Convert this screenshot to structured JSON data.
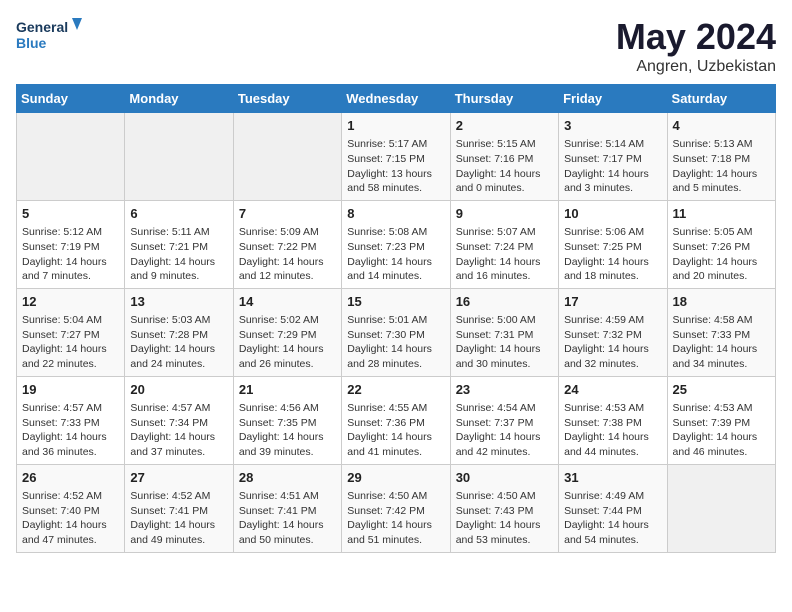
{
  "logo": {
    "line1": "General",
    "line2": "Blue"
  },
  "title": "May 2024",
  "location": "Angren, Uzbekistan",
  "days_header": [
    "Sunday",
    "Monday",
    "Tuesday",
    "Wednesday",
    "Thursday",
    "Friday",
    "Saturday"
  ],
  "weeks": [
    [
      {
        "day": "",
        "info": ""
      },
      {
        "day": "",
        "info": ""
      },
      {
        "day": "",
        "info": ""
      },
      {
        "day": "1",
        "info": "Sunrise: 5:17 AM\nSunset: 7:15 PM\nDaylight: 13 hours\nand 58 minutes."
      },
      {
        "day": "2",
        "info": "Sunrise: 5:15 AM\nSunset: 7:16 PM\nDaylight: 14 hours\nand 0 minutes."
      },
      {
        "day": "3",
        "info": "Sunrise: 5:14 AM\nSunset: 7:17 PM\nDaylight: 14 hours\nand 3 minutes."
      },
      {
        "day": "4",
        "info": "Sunrise: 5:13 AM\nSunset: 7:18 PM\nDaylight: 14 hours\nand 5 minutes."
      }
    ],
    [
      {
        "day": "5",
        "info": "Sunrise: 5:12 AM\nSunset: 7:19 PM\nDaylight: 14 hours\nand 7 minutes."
      },
      {
        "day": "6",
        "info": "Sunrise: 5:11 AM\nSunset: 7:21 PM\nDaylight: 14 hours\nand 9 minutes."
      },
      {
        "day": "7",
        "info": "Sunrise: 5:09 AM\nSunset: 7:22 PM\nDaylight: 14 hours\nand 12 minutes."
      },
      {
        "day": "8",
        "info": "Sunrise: 5:08 AM\nSunset: 7:23 PM\nDaylight: 14 hours\nand 14 minutes."
      },
      {
        "day": "9",
        "info": "Sunrise: 5:07 AM\nSunset: 7:24 PM\nDaylight: 14 hours\nand 16 minutes."
      },
      {
        "day": "10",
        "info": "Sunrise: 5:06 AM\nSunset: 7:25 PM\nDaylight: 14 hours\nand 18 minutes."
      },
      {
        "day": "11",
        "info": "Sunrise: 5:05 AM\nSunset: 7:26 PM\nDaylight: 14 hours\nand 20 minutes."
      }
    ],
    [
      {
        "day": "12",
        "info": "Sunrise: 5:04 AM\nSunset: 7:27 PM\nDaylight: 14 hours\nand 22 minutes."
      },
      {
        "day": "13",
        "info": "Sunrise: 5:03 AM\nSunset: 7:28 PM\nDaylight: 14 hours\nand 24 minutes."
      },
      {
        "day": "14",
        "info": "Sunrise: 5:02 AM\nSunset: 7:29 PM\nDaylight: 14 hours\nand 26 minutes."
      },
      {
        "day": "15",
        "info": "Sunrise: 5:01 AM\nSunset: 7:30 PM\nDaylight: 14 hours\nand 28 minutes."
      },
      {
        "day": "16",
        "info": "Sunrise: 5:00 AM\nSunset: 7:31 PM\nDaylight: 14 hours\nand 30 minutes."
      },
      {
        "day": "17",
        "info": "Sunrise: 4:59 AM\nSunset: 7:32 PM\nDaylight: 14 hours\nand 32 minutes."
      },
      {
        "day": "18",
        "info": "Sunrise: 4:58 AM\nSunset: 7:33 PM\nDaylight: 14 hours\nand 34 minutes."
      }
    ],
    [
      {
        "day": "19",
        "info": "Sunrise: 4:57 AM\nSunset: 7:33 PM\nDaylight: 14 hours\nand 36 minutes."
      },
      {
        "day": "20",
        "info": "Sunrise: 4:57 AM\nSunset: 7:34 PM\nDaylight: 14 hours\nand 37 minutes."
      },
      {
        "day": "21",
        "info": "Sunrise: 4:56 AM\nSunset: 7:35 PM\nDaylight: 14 hours\nand 39 minutes."
      },
      {
        "day": "22",
        "info": "Sunrise: 4:55 AM\nSunset: 7:36 PM\nDaylight: 14 hours\nand 41 minutes."
      },
      {
        "day": "23",
        "info": "Sunrise: 4:54 AM\nSunset: 7:37 PM\nDaylight: 14 hours\nand 42 minutes."
      },
      {
        "day": "24",
        "info": "Sunrise: 4:53 AM\nSunset: 7:38 PM\nDaylight: 14 hours\nand 44 minutes."
      },
      {
        "day": "25",
        "info": "Sunrise: 4:53 AM\nSunset: 7:39 PM\nDaylight: 14 hours\nand 46 minutes."
      }
    ],
    [
      {
        "day": "26",
        "info": "Sunrise: 4:52 AM\nSunset: 7:40 PM\nDaylight: 14 hours\nand 47 minutes."
      },
      {
        "day": "27",
        "info": "Sunrise: 4:52 AM\nSunset: 7:41 PM\nDaylight: 14 hours\nand 49 minutes."
      },
      {
        "day": "28",
        "info": "Sunrise: 4:51 AM\nSunset: 7:41 PM\nDaylight: 14 hours\nand 50 minutes."
      },
      {
        "day": "29",
        "info": "Sunrise: 4:50 AM\nSunset: 7:42 PM\nDaylight: 14 hours\nand 51 minutes."
      },
      {
        "day": "30",
        "info": "Sunrise: 4:50 AM\nSunset: 7:43 PM\nDaylight: 14 hours\nand 53 minutes."
      },
      {
        "day": "31",
        "info": "Sunrise: 4:49 AM\nSunset: 7:44 PM\nDaylight: 14 hours\nand 54 minutes."
      },
      {
        "day": "",
        "info": ""
      }
    ]
  ]
}
